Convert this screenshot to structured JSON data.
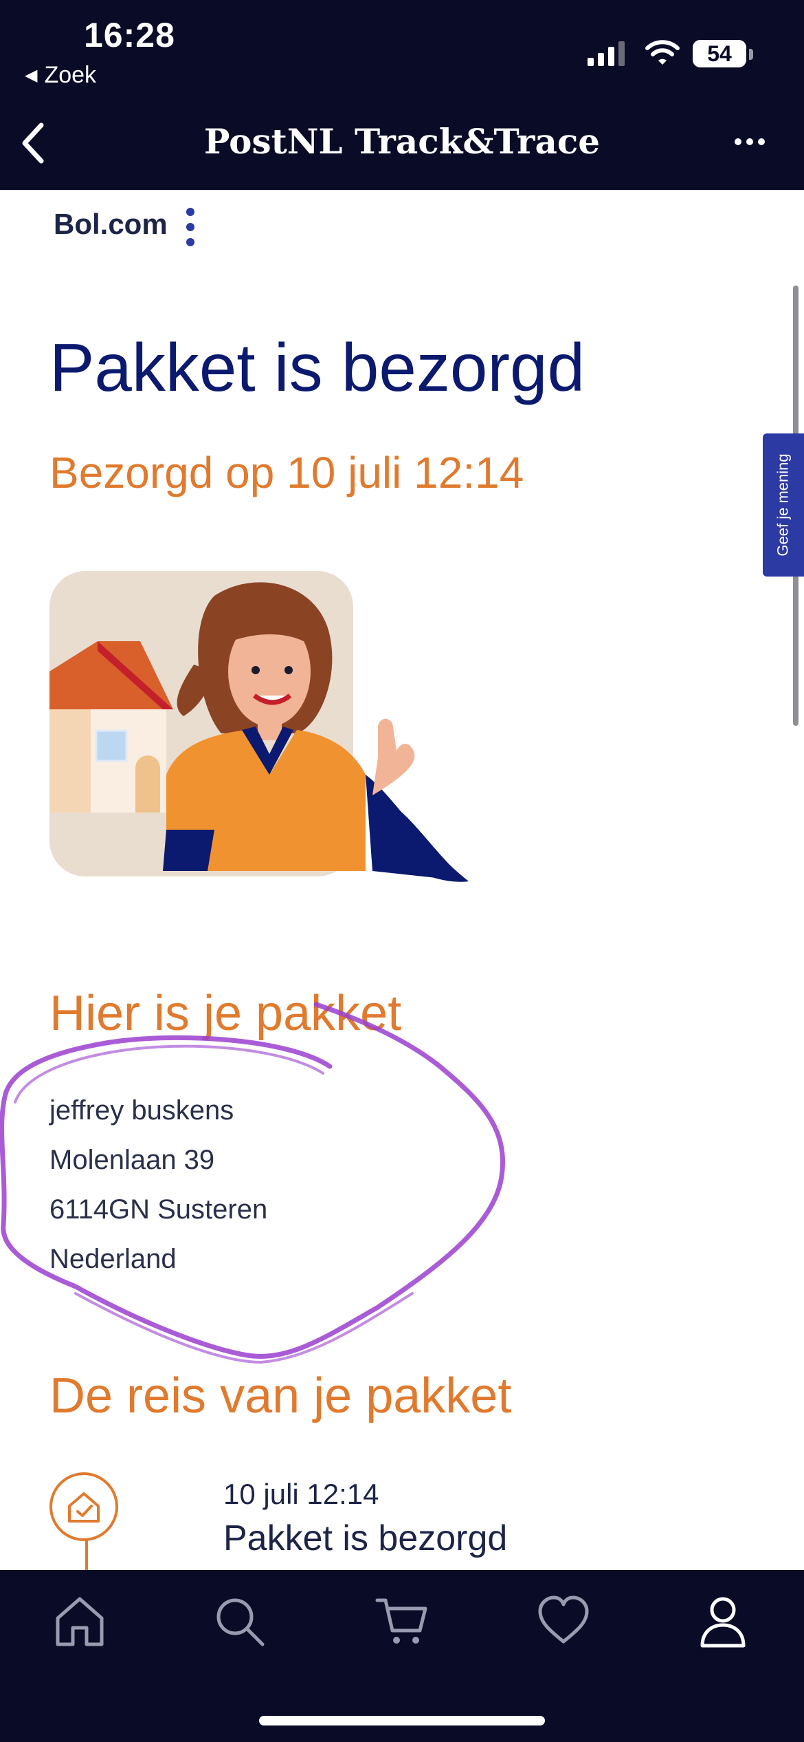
{
  "status_bar": {
    "time": "16:28",
    "back_app": "Zoek",
    "battery": "54",
    "icons": [
      "signal-icon",
      "wifi-icon",
      "battery-icon"
    ]
  },
  "nav": {
    "title": "PostNL Track&Trace",
    "back_icon": "chevron-left-icon",
    "more_icon": "more-horizontal-icon"
  },
  "sender": {
    "name": "Bol.com",
    "menu_icon": "vertical-dots-icon"
  },
  "feedback": {
    "label": "Geef je mening"
  },
  "status": {
    "heading": "Pakket is bezorgd",
    "delivered_on": "Bezorgd op 10 juli 12:14"
  },
  "address": {
    "heading": "Hier is je pakket",
    "lines": [
      "jeffrey buskens",
      "Molenlaan 39",
      "6114GN Susteren",
      "Nederland"
    ]
  },
  "journey": {
    "heading": "De reis van je pakket",
    "events": [
      {
        "time": "10 juli 12:14",
        "title": "Pakket is bezorgd",
        "icon": "home-check-icon"
      }
    ]
  },
  "tabbar": {
    "items": [
      {
        "name": "home",
        "icon": "home-icon"
      },
      {
        "name": "search",
        "icon": "search-icon"
      },
      {
        "name": "cart",
        "icon": "cart-icon"
      },
      {
        "name": "favorites",
        "icon": "heart-icon"
      },
      {
        "name": "account",
        "icon": "user-icon",
        "active": true
      }
    ]
  },
  "colors": {
    "header_bg": "#0a0b26",
    "heading_blue": "#0b1a6e",
    "accent_orange": "#e07a2e",
    "feedback_tab": "#2c3aa3",
    "scribble_purple": "#9b3fd0"
  }
}
